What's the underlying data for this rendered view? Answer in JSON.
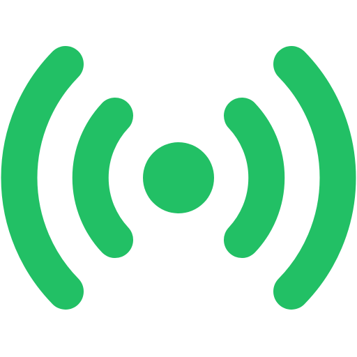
{
  "icon": {
    "name": "broadcast-icon",
    "color": "#22C065"
  }
}
